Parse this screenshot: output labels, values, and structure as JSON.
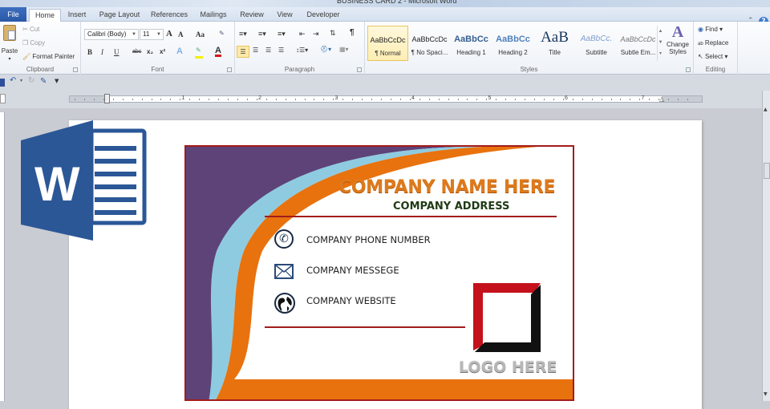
{
  "window": {
    "title": "BUSINESS CARD 2 - Microsoft Word"
  },
  "tabs": [
    {
      "label": "File",
      "active": false
    },
    {
      "label": "Home",
      "active": true
    },
    {
      "label": "Insert",
      "active": false
    },
    {
      "label": "Page Layout",
      "active": false
    },
    {
      "label": "References",
      "active": false
    },
    {
      "label": "Mailings",
      "active": false
    },
    {
      "label": "Review",
      "active": false
    },
    {
      "label": "View",
      "active": false
    },
    {
      "label": "Developer",
      "active": false
    }
  ],
  "ribbon": {
    "clipboard": {
      "label": "Clipboard",
      "paste": "Paste",
      "cut": "Cut",
      "copy": "Copy",
      "format_painter": "Format Painter"
    },
    "font": {
      "label": "Font",
      "font_name": "Calibri (Body)",
      "font_size": "11",
      "grow": "A",
      "shrink": "A",
      "change_case": "Aa",
      "bold": "B",
      "italic": "I",
      "underline": "U",
      "strikethrough": "abc",
      "subscript": "x₂",
      "superscript": "x²",
      "text_effects": "A",
      "font_color": "A"
    },
    "paragraph": {
      "label": "Paragraph",
      "show_marks": "¶"
    },
    "styles": {
      "label": "Styles",
      "items": [
        {
          "sample": "AaBbCcDc",
          "name": "¶ Normal",
          "selected": true
        },
        {
          "sample": "AaBbCcDc",
          "name": "¶ No Spaci...",
          "selected": false
        },
        {
          "sample": "AaBbCc",
          "name": "Heading 1",
          "selected": false
        },
        {
          "sample": "AaBbCc",
          "name": "Heading 2",
          "selected": false
        },
        {
          "sample": "AaB",
          "name": "Title",
          "selected": false
        },
        {
          "sample": "AaBbCc.",
          "name": "Subtitle",
          "selected": false
        },
        {
          "sample": "AaBbCcDc",
          "name": "Subtle Em...",
          "selected": false
        }
      ],
      "change_styles": "Change Styles"
    },
    "editing": {
      "label": "Editing",
      "find": "Find",
      "replace": "Replace",
      "select": "Select"
    }
  },
  "ruler": {
    "numbers": [
      "1",
      "2",
      "3",
      "4",
      "5",
      "6",
      "7"
    ]
  },
  "card": {
    "company_name": "COMPANY NAME HERE",
    "company_address": "COMPANY ADDRESS",
    "contacts": [
      {
        "icon": "phone-icon",
        "text": "COMPANY PHONE NUMBER"
      },
      {
        "icon": "envelope-icon",
        "text": "COMPANY MESSEGE"
      },
      {
        "icon": "globe-icon",
        "text": "COMPANY WEBSITE"
      }
    ],
    "logo_text": "LOGO HERE",
    "colors": {
      "purple": "#5e4378",
      "light_blue": "#8fcbe0",
      "orange": "#e8720e",
      "border_red": "#a31c1c",
      "logo_red": "#c4111b",
      "name_orange": "#dd7a1c",
      "address_green": "#1f3a14"
    }
  },
  "overlay": {
    "word_logo_letter": "W",
    "word_logo_color": "#2b5797"
  }
}
